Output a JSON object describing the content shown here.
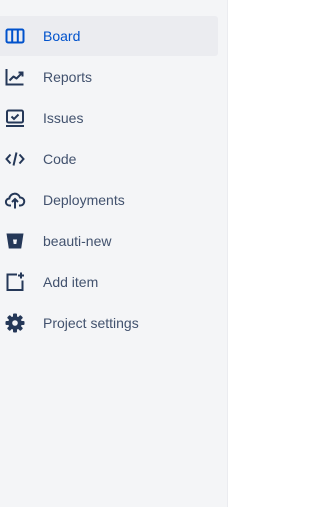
{
  "sidebar": {
    "items": [
      {
        "label": "Board",
        "icon": "board-icon",
        "active": true
      },
      {
        "label": "Reports",
        "icon": "reports-icon",
        "active": false
      },
      {
        "label": "Issues",
        "icon": "issues-icon",
        "active": false
      },
      {
        "label": "Code",
        "icon": "code-icon",
        "active": false
      },
      {
        "label": "Deployments",
        "icon": "deployments-icon",
        "active": false
      },
      {
        "label": "beauti-new",
        "icon": "bitbucket-repo-icon",
        "active": false
      },
      {
        "label": "Add item",
        "icon": "add-item-icon",
        "active": false
      },
      {
        "label": "Project settings",
        "icon": "gear-icon",
        "active": false
      }
    ]
  },
  "colors": {
    "sidebar_bg": "#f4f5f7",
    "active_bg": "#ebecf0",
    "active_text": "#0052cc",
    "text": "#42526e",
    "icon": "#253858"
  }
}
